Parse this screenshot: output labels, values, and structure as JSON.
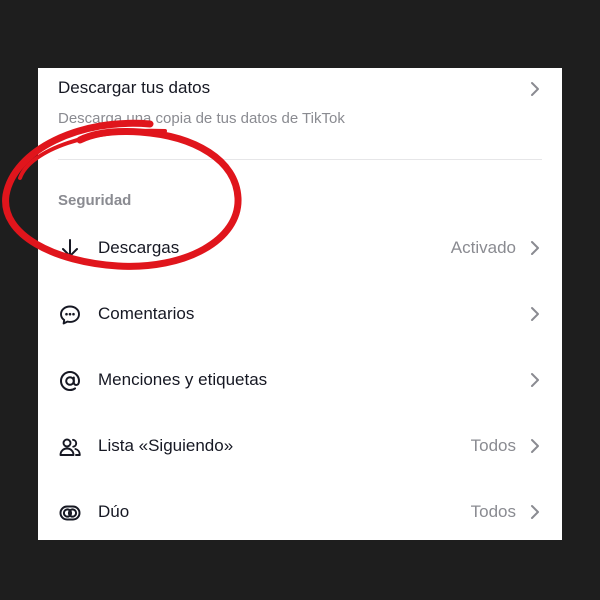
{
  "download": {
    "title": "Descargar tus datos",
    "subtitle": "Descarga una copia de tus datos de TikTok"
  },
  "section": {
    "header": "Seguridad"
  },
  "rows": [
    {
      "label": "Descargas",
      "value": "Activado",
      "icon": "download-icon"
    },
    {
      "label": "Comentarios",
      "value": "",
      "icon": "comment-icon"
    },
    {
      "label": "Menciones y etiquetas",
      "value": "",
      "icon": "at-sign-icon"
    },
    {
      "label": "Lista «Siguiendo»",
      "value": "Todos",
      "icon": "people-icon"
    },
    {
      "label": "Dúo",
      "value": "Todos",
      "icon": "duet-icon"
    }
  ],
  "colors": {
    "background": "#1e1e1e",
    "panel": "#ffffff",
    "text_primary": "#161823",
    "text_secondary": "#8a8b91",
    "annotation": "#e0151c"
  }
}
